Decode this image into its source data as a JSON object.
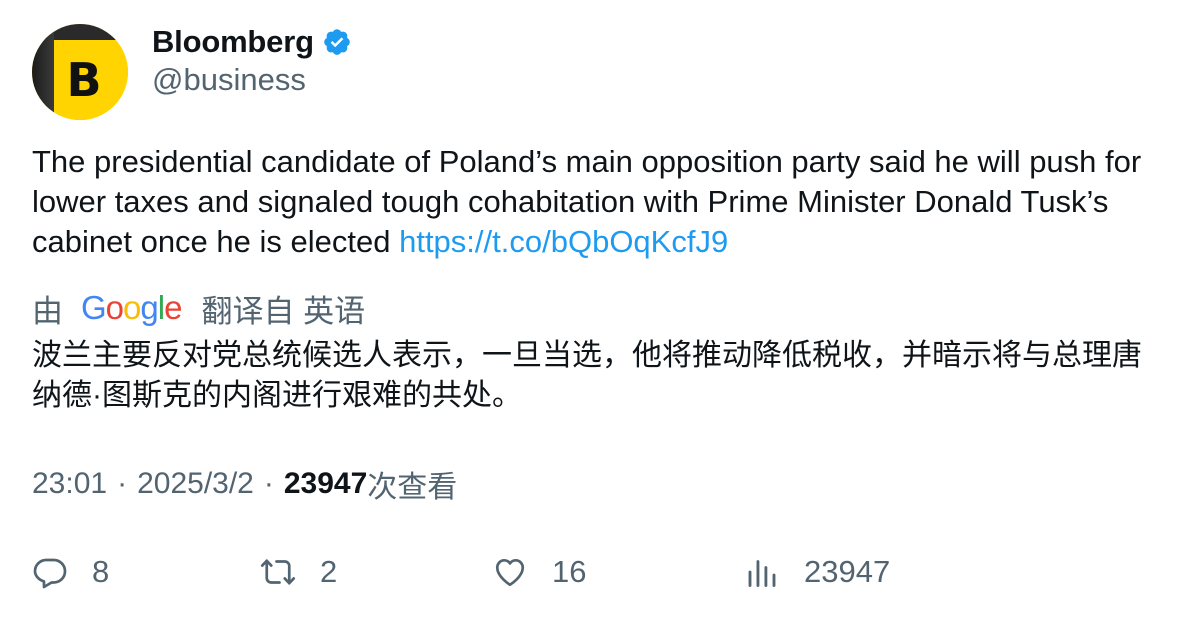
{
  "author": {
    "display_name": "Bloomberg",
    "handle": "@business",
    "avatar_letter": "B",
    "verified_icon": "verified-badge-icon",
    "verified_color": "#1d9bf0",
    "avatar_color": "#ffd400"
  },
  "tweet": {
    "text": "The presidential candidate of Poland’s main opposition party said he will push for lower taxes and signaled tough cohabitation with Prime Minister Donald Tusk’s cabinet once he is elected ",
    "link": "https://t.co/bQbOqKcfJ9",
    "link_color": "#1d9bf0"
  },
  "translation": {
    "by_label": "由",
    "provider": "Google",
    "action_label": "翻译自 英语",
    "text": "波兰主要反对党总统候选人表示，一旦当选，他将推动降低税收，并暗示将与总理唐纳德·图斯克的内阁进行艰难的共处。"
  },
  "meta": {
    "time": "23:01",
    "separator": "·",
    "date": "2025/3/2",
    "views_count": "23947",
    "views_label": "次查看"
  },
  "actions": {
    "reply": {
      "icon": "reply-icon",
      "count": "8"
    },
    "retweet": {
      "icon": "retweet-icon",
      "count": "2"
    },
    "like": {
      "icon": "heart-icon",
      "count": "16"
    },
    "views": {
      "icon": "analytics-icon",
      "count": "23947"
    }
  }
}
